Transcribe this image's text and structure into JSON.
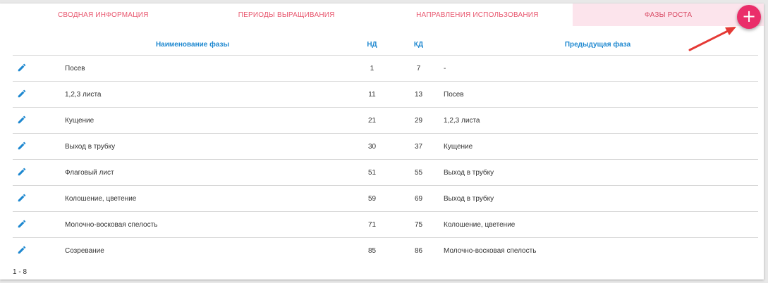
{
  "tabs": [
    {
      "label": "Сводная информация",
      "active": false
    },
    {
      "label": "Периоды выращивания",
      "active": false
    },
    {
      "label": "Направления использования",
      "active": false
    },
    {
      "label": "Фазы роста",
      "active": true
    }
  ],
  "fab": {
    "label": "+",
    "icon": "plus-icon",
    "color": "#ea2e6a"
  },
  "annotation": {
    "icon": "red-arrow",
    "color": "#e53935"
  },
  "table": {
    "columns": [
      "",
      "Наименование фазы",
      "НД",
      "КД",
      "Предыдущая фаза"
    ],
    "rows": [
      {
        "name": "Посев",
        "nd": "1",
        "kd": "7",
        "prev": "-"
      },
      {
        "name": "1,2,3 листа",
        "nd": "11",
        "kd": "13",
        "prev": "Посев"
      },
      {
        "name": "Кущение",
        "nd": "21",
        "kd": "29",
        "prev": "1,2,3 листа"
      },
      {
        "name": "Выход в трубку",
        "nd": "30",
        "kd": "37",
        "prev": "Кущение"
      },
      {
        "name": "Флаговый лист",
        "nd": "51",
        "kd": "55",
        "prev": "Выход в трубку"
      },
      {
        "name": "Колошение, цветение",
        "nd": "59",
        "kd": "69",
        "prev": "Выход в трубку"
      },
      {
        "name": "Молочно-восковая спелость",
        "nd": "71",
        "kd": "75",
        "prev": "Колошение, цветение"
      },
      {
        "name": "Созревание",
        "nd": "85",
        "kd": "86",
        "prev": "Молочно-восковая спелость"
      }
    ]
  },
  "pager": {
    "range": "1 - 8"
  },
  "colors": {
    "accent": "#1e88d0",
    "tab_text": "#e8566e",
    "active_tab_bg": "#fce4ec"
  }
}
